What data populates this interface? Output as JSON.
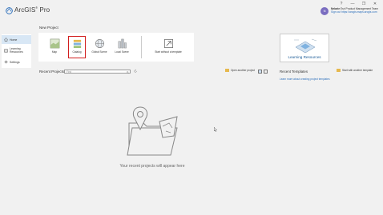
{
  "app": {
    "title": "ArcGIS",
    "title_suffix": "Pro",
    "registered_mark": "®"
  },
  "window_controls": [
    "?",
    "—",
    "❐",
    "✕"
  ],
  "user": {
    "initials": "N",
    "name": "Nelarie",
    "org": "Esri Product Management Team",
    "sign_out": "Sign out",
    "portal": "https://arcgis.maps.arcgis.com"
  },
  "sidebar": {
    "items": [
      {
        "label": "Home",
        "icon": "home-icon"
      },
      {
        "label": "Learning Resources",
        "icon": "book-icon"
      },
      {
        "label": "Settings",
        "icon": "gear-icon"
      }
    ]
  },
  "new_project": {
    "heading": "New Project",
    "tiles": [
      {
        "label": "Map",
        "icon": "map-icon"
      },
      {
        "label": "Catalog",
        "icon": "catalog-icon"
      },
      {
        "label": "Global Scene",
        "icon": "globe-icon"
      },
      {
        "label": "Local Scene",
        "icon": "local-scene-icon"
      },
      {
        "label": "Start without a template",
        "icon": "arrow-icon"
      }
    ]
  },
  "learning_resources": {
    "label": "Learning Resources"
  },
  "recent_projects": {
    "heading": "Recent Projects",
    "search_placeholder": "Find",
    "open_another": "Open another project",
    "empty_message": "Your recent projects will appear here"
  },
  "recent_templates": {
    "heading": "Recent Templates",
    "start_another": "Start with another template",
    "learn_more": "Learn more about creating project templates"
  },
  "colors": {
    "accent": "#2a6ebb",
    "selection": "#d21e1e",
    "background": "#f1f1f1"
  }
}
